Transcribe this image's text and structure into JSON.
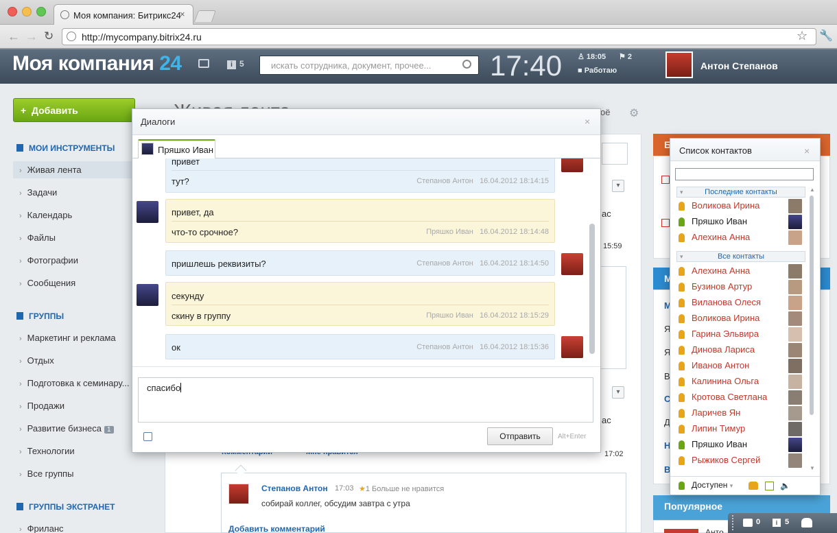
{
  "browser": {
    "tab_title": "Моя компания: Битрикс24",
    "url": "http://mycompany.bitrix24.ru"
  },
  "header": {
    "logo_text": "Моя компания",
    "logo_number": "24",
    "notif_count": "5",
    "search_placeholder": "искать сотрудника, документ, прочее...",
    "clock": "17:40",
    "work_time": "18:05",
    "flag_count": "2",
    "work_status": "Работаю",
    "user_name": "Антон Степанов"
  },
  "sidebar": {
    "add_button": "Добавить",
    "sections": [
      {
        "title": "МОИ ИНСТРУМЕНТЫ",
        "items": [
          "Живая лента",
          "Задачи",
          "Календарь",
          "Файлы",
          "Фотографии",
          "Сообщения"
        ]
      },
      {
        "title": "ГРУППЫ",
        "items": [
          "Маркетинг и реклама",
          "Отдых",
          "Подготовка к семинару...",
          "Продажи",
          "Развитие бизнеса",
          "Технологии",
          "Все группы"
        ]
      },
      {
        "title": "ГРУППЫ ЭКСТРАНЕТ",
        "items": [
          "Фриланс"
        ]
      }
    ],
    "group_badge": "1"
  },
  "feed": {
    "title": "Живая лента",
    "mine_label": "оё",
    "bg_texts": [
      "ас",
      "15:59",
      "ас",
      "17:02",
      "Комментарии",
      "Мне нравится"
    ],
    "comment": {
      "author": "Степанов Антон",
      "time": "17:03",
      "like": "1 Больше не нравится",
      "text": "собирай коллег, обсудим завтра с утра",
      "add_comment": "Добавить комментарий"
    }
  },
  "right": {
    "popular": "Популярное",
    "popular_name": "Анто",
    "partial": [
      "Б",
      "М",
      "М",
      "Я",
      "Я",
      "В",
      "С",
      "Д",
      "Н",
      "В"
    ]
  },
  "dialog": {
    "title": "Диалоги",
    "tab_name": "Пряшко Иван",
    "messages": [
      {
        "side": "me",
        "lines": [
          "привет",
          "тут?"
        ],
        "author": "Степанов Антон",
        "time": "16.04.2012 18:14:15"
      },
      {
        "side": "him",
        "lines": [
          "привет, да",
          "что-то срочное?"
        ],
        "author": "Пряшко Иван",
        "time": "16.04.2012 18:14:48"
      },
      {
        "side": "me",
        "lines": [
          "пришлешь реквизиты?"
        ],
        "author": "Степанов Антон",
        "time": "16.04.2012 18:14:50"
      },
      {
        "side": "him",
        "lines": [
          "секунду",
          "скину в группу"
        ],
        "author": "Пряшко Иван",
        "time": "16.04.2012 18:15:29"
      },
      {
        "side": "me",
        "lines": [
          "ок"
        ],
        "author": "Степанов Антон",
        "time": "16.04.2012 18:15:36"
      }
    ],
    "input_value": "спасибо",
    "send_label": "Отправить",
    "send_hint": "Alt+Enter"
  },
  "contacts": {
    "title": "Список контактов",
    "recent_label": "Последние контакты",
    "all_label": "Все контакты",
    "recent": [
      {
        "name": "Воликова Ирина",
        "online": false
      },
      {
        "name": "Пряшко Иван",
        "online": true
      },
      {
        "name": "Алехина Анна",
        "online": false
      }
    ],
    "all": [
      {
        "name": "Алехина Анна",
        "online": false
      },
      {
        "name": "Бузинов Артур",
        "online": false
      },
      {
        "name": "Виланова Олеся",
        "online": false
      },
      {
        "name": "Воликова Ирина",
        "online": false
      },
      {
        "name": "Гарина Эльвира",
        "online": false
      },
      {
        "name": "Динова Лариса",
        "online": false
      },
      {
        "name": "Иванов Антон",
        "online": false
      },
      {
        "name": "Калинина Ольга",
        "online": false
      },
      {
        "name": "Кротова Светлана",
        "online": false
      },
      {
        "name": "Ларичев Ян",
        "online": false
      },
      {
        "name": "Липин Тимур",
        "online": false
      },
      {
        "name": "Пряшко Иван",
        "online": true
      },
      {
        "name": "Рыжиков Сергей",
        "online": false
      }
    ],
    "status": "Доступен"
  },
  "bottombar": {
    "chat_count": "0",
    "notif_count": "5"
  },
  "colors": {
    "accent": "#2067b0",
    "offline_name": "#c0392b",
    "green": "#6aa613"
  }
}
